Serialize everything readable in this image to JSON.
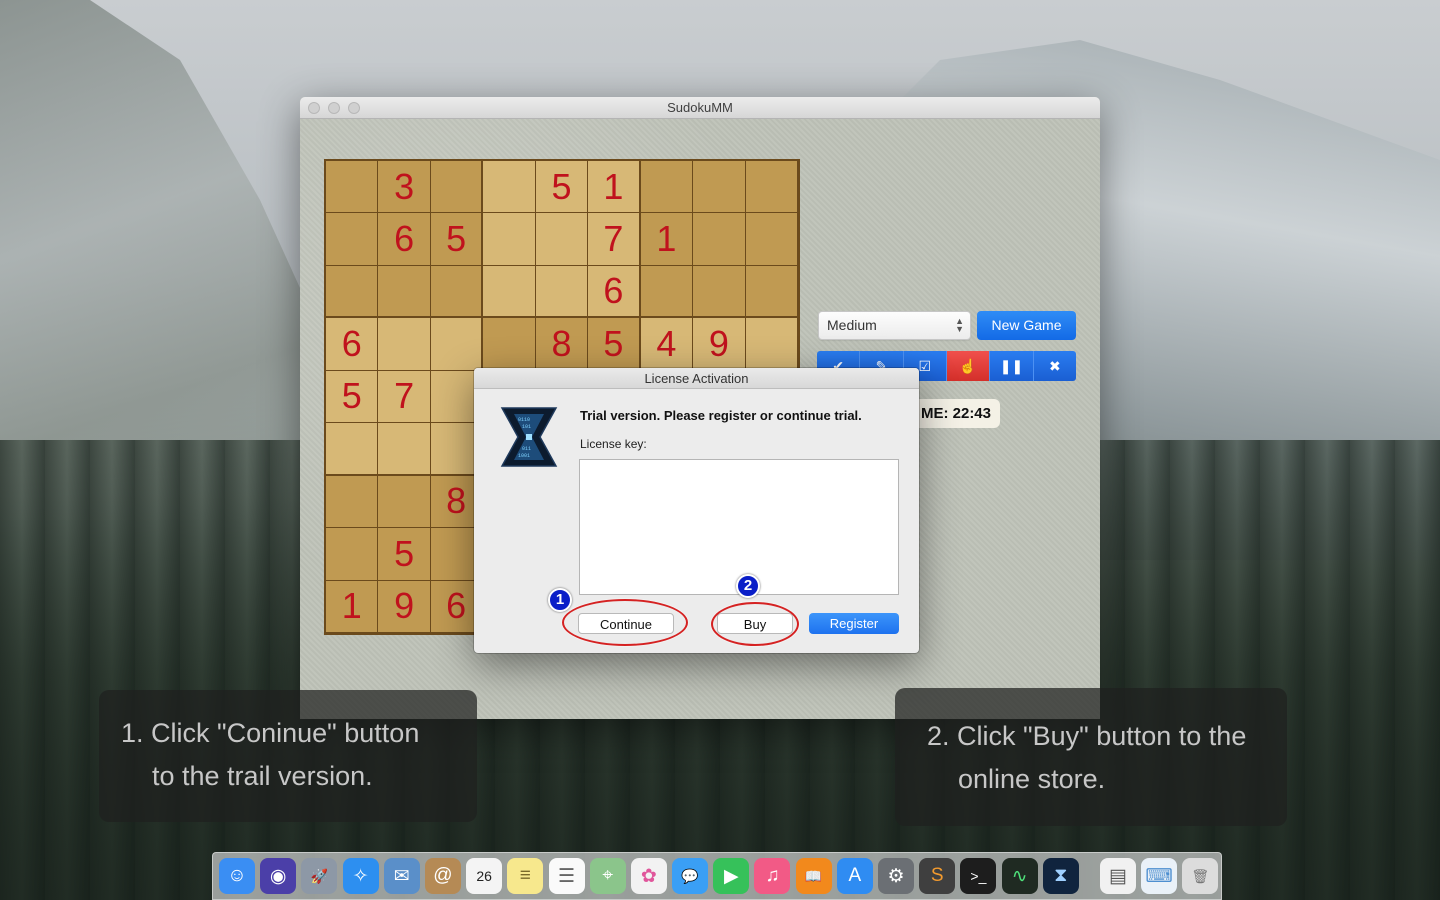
{
  "window": {
    "title": "SudokuMM"
  },
  "board": {
    "rows": [
      [
        "",
        "3",
        "",
        "",
        "5",
        "1",
        "",
        "",
        ""
      ],
      [
        "",
        "6",
        "5",
        "",
        "",
        "7",
        "1",
        "",
        ""
      ],
      [
        "",
        "",
        "",
        "",
        "",
        "6",
        "",
        "",
        ""
      ],
      [
        "6",
        "",
        "",
        "",
        "8",
        "5",
        "4",
        "9",
        ""
      ],
      [
        "5",
        "7",
        "",
        "",
        "",
        "",
        "",
        "",
        ""
      ],
      [
        "",
        "",
        "",
        "",
        "",
        "",
        "",
        "",
        ""
      ],
      [
        "",
        "",
        "8",
        "",
        "",
        "",
        "",
        "",
        ""
      ],
      [
        "",
        "5",
        "",
        "",
        "",
        "",
        "",
        "",
        ""
      ],
      [
        "1",
        "9",
        "6",
        "",
        "",
        "",
        "",
        "",
        ""
      ]
    ]
  },
  "controls": {
    "level_value": "Medium",
    "new_game_label": "New Game",
    "timer_text": "ME: 22:43",
    "tools": [
      {
        "name": "check-icon",
        "glyph": "✔"
      },
      {
        "name": "pencil-icon",
        "glyph": "✎"
      },
      {
        "name": "edit-check-icon",
        "glyph": "☑"
      },
      {
        "name": "hand-pointer-icon",
        "glyph": "☝"
      },
      {
        "name": "pause-icon",
        "glyph": "❚❚"
      },
      {
        "name": "close-icon",
        "glyph": "✖"
      }
    ]
  },
  "dialog": {
    "title": "License Activation",
    "message": "Trial version. Please register or continue trial.",
    "key_label": "License key:",
    "key_value": "",
    "continue_label": "Continue",
    "buy_label": "Buy",
    "register_label": "Register"
  },
  "annotations": {
    "marker1": "1",
    "marker2": "2",
    "caption1_line1": "1. Click \"Coninue\" button",
    "caption1_line2": "to the trail version.",
    "caption2_line1": "2. Click \"Buy\" button to the",
    "caption2_line2": "online store."
  },
  "dock": {
    "items": [
      {
        "name": "finder-icon",
        "glyph": "☺",
        "color": "#3a8ef3"
      },
      {
        "name": "siri-icon",
        "glyph": "◉",
        "color": "#4b3fa8"
      },
      {
        "name": "launchpad-icon",
        "glyph": "🚀",
        "color": "#8d98a6"
      },
      {
        "name": "safari-icon",
        "glyph": "✧",
        "color": "#2d8ff0"
      },
      {
        "name": "mail-icon",
        "glyph": "✉",
        "color": "#5a8fc9"
      },
      {
        "name": "contacts-icon",
        "glyph": "@",
        "color": "#b58a55"
      },
      {
        "name": "calendar-icon",
        "glyph": "26",
        "color": "#f4f4f4",
        "text": "#222"
      },
      {
        "name": "notes-icon",
        "glyph": "≡",
        "color": "#f7e88d",
        "text": "#7a6a2a"
      },
      {
        "name": "reminders-icon",
        "glyph": "☰",
        "color": "#fafafa",
        "text": "#666"
      },
      {
        "name": "maps-icon",
        "glyph": "⌖",
        "color": "#8bc58b"
      },
      {
        "name": "photos-icon",
        "glyph": "✿",
        "color": "#f2f2f2",
        "text": "#e0569b"
      },
      {
        "name": "messages-icon",
        "glyph": "💬",
        "color": "#3a9ff5"
      },
      {
        "name": "facetime-icon",
        "glyph": "▶",
        "color": "#36c15a"
      },
      {
        "name": "itunes-icon",
        "glyph": "♫",
        "color": "#f25a86"
      },
      {
        "name": "ibooks-icon",
        "glyph": "📖",
        "color": "#f2891c"
      },
      {
        "name": "app-store-icon",
        "glyph": "A",
        "color": "#2f8cf2"
      },
      {
        "name": "system-preferences-icon",
        "glyph": "⚙",
        "color": "#6b6f74"
      },
      {
        "name": "sublime-text-icon",
        "glyph": "S",
        "color": "#3f3f3f",
        "text": "#f29a2e"
      },
      {
        "name": "terminal-icon",
        "glyph": ">_",
        "color": "#1d1d1d"
      },
      {
        "name": "activity-monitor-icon",
        "glyph": "∿",
        "color": "#1f2a22",
        "text": "#4ee07a"
      },
      {
        "name": "sudokumm-icon",
        "glyph": "⧗",
        "color": "#10243e",
        "text": "#9fd0ff"
      }
    ],
    "right_items": [
      {
        "name": "document-icon",
        "glyph": "▤",
        "color": "#f1f1f1",
        "text": "#555"
      },
      {
        "name": "screenshots-folder-icon",
        "glyph": "⌨",
        "color": "#eaf1f8",
        "text": "#4e8fd0"
      },
      {
        "name": "trash-icon",
        "glyph": "🗑",
        "color": "#dcdcdc",
        "text": "#777"
      }
    ]
  }
}
